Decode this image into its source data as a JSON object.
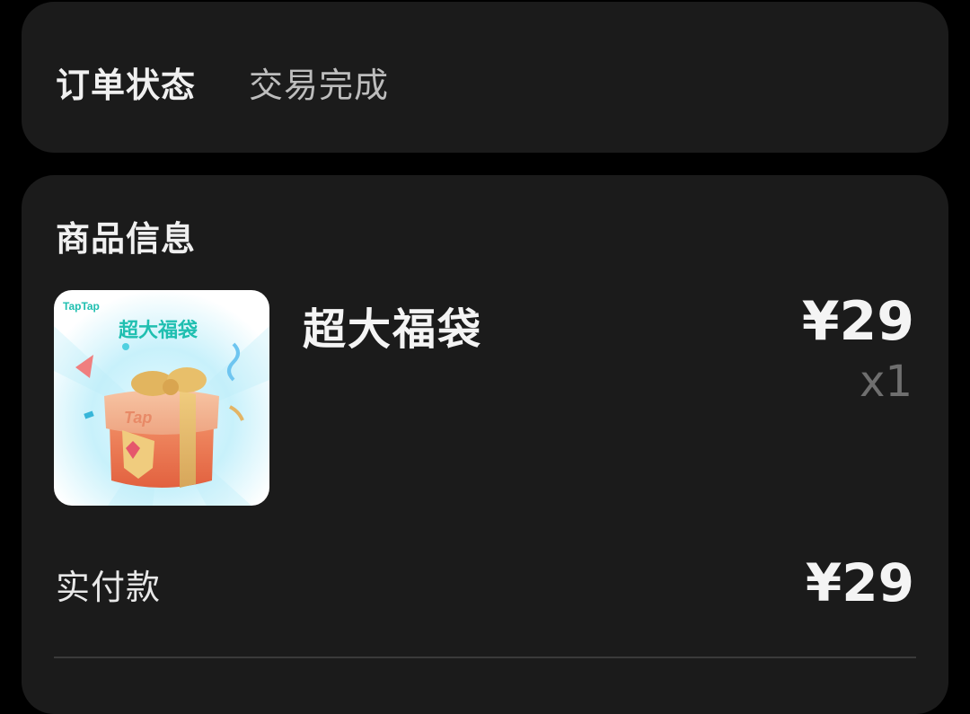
{
  "order_status": {
    "label": "订单状态",
    "value": "交易完成"
  },
  "goods_info": {
    "title": "商品信息",
    "product": {
      "thumbnail_brand": "TapTap",
      "thumbnail_title": "超大福袋",
      "thumbnail_box_text": "Tap",
      "name": "超大福袋",
      "price": "¥29",
      "quantity": "x1"
    },
    "paid_label": "实付款",
    "paid_value": "¥29"
  },
  "colors": {
    "background": "#000000",
    "card": "#1b1b1b",
    "brand_teal": "#1fbfb0",
    "gift_orange": "#e8704c"
  }
}
